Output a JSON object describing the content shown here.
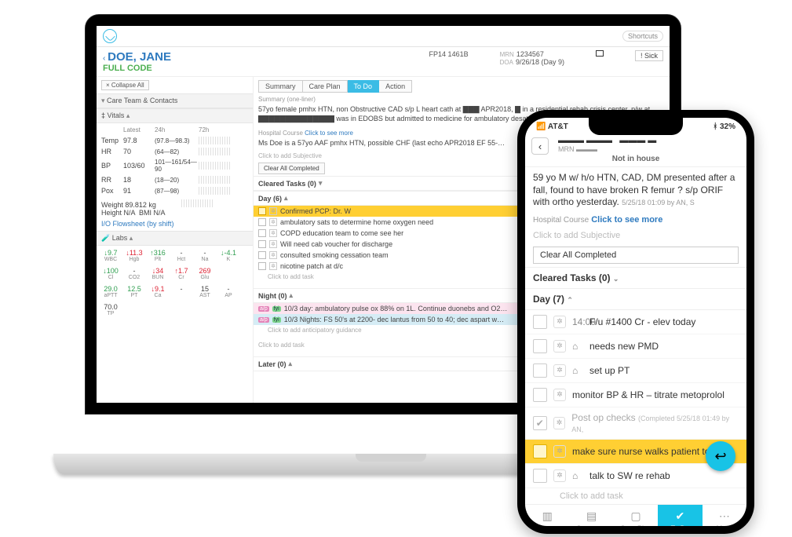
{
  "laptop": {
    "shortcut": "Shortcuts",
    "patient": {
      "name": "DOE, JANE",
      "code": "FULL CODE",
      "fp": "FP14 1461B",
      "mrn_label": "MRN",
      "mrn": "1234567",
      "doa_label": "DOA",
      "doa": "9/26/18 (Day 9)",
      "sick": "! Sick"
    },
    "collapse_all": "× Collapse All",
    "sidebar": {
      "care_team": "Care Team & Contacts",
      "vitals_label": "Vitals",
      "cols": {
        "latest": "Latest",
        "h24": "24h",
        "h72": "72h"
      },
      "vitals": [
        {
          "name": "Temp",
          "latest": "97.8",
          "h24": "(97.8—98.3)"
        },
        {
          "name": "HR",
          "latest": "70",
          "h24": "(64—82)"
        },
        {
          "name": "BP",
          "latest": "103/60",
          "h24": "101—161/54—90"
        },
        {
          "name": "RR",
          "latest": "18",
          "h24": "(18—20)"
        },
        {
          "name": "Pox",
          "latest": "91",
          "h24": "(87—98)"
        }
      ],
      "weight": "Weight 89.812 kg",
      "height": "Height N/A",
      "bmi": "BMI N/A",
      "flowsheet": "I/O Flowsheet (by shift)",
      "labs_label": "Labs",
      "labs1": [
        {
          "v": "↓9.7",
          "n": "WBC",
          "c": "green"
        },
        {
          "v": "↓11.3",
          "n": "Hgb",
          "c": "red"
        },
        {
          "v": "↑316",
          "n": "Plt",
          "c": "green"
        },
        {
          "v": "-",
          "n": "Hct",
          "c": ""
        },
        {
          "v": "-",
          "n": "Na",
          "c": ""
        },
        {
          "v": "↓-4.1",
          "n": "K",
          "c": "green"
        },
        {
          "v": "↓100",
          "n": "Cl",
          "c": "green"
        },
        {
          "v": "-",
          "n": "CO2",
          "c": ""
        },
        {
          "v": "↓34",
          "n": "BUN",
          "c": "red"
        },
        {
          "v": "↑1.7",
          "n": "Cr",
          "c": "red"
        },
        {
          "v": "269",
          "n": "Glu",
          "c": "red"
        }
      ],
      "labs2": [
        {
          "v": "29.0",
          "n": "aPTT",
          "c": "green"
        },
        {
          "v": "12.5",
          "n": "PT",
          "c": "green"
        },
        {
          "v": "↓9.1",
          "n": "Ca",
          "c": "red"
        },
        {
          "v": "-",
          "n": "",
          "c": ""
        },
        {
          "v": "15",
          "n": "AST",
          "c": ""
        },
        {
          "v": "-",
          "n": "AP",
          "c": ""
        },
        {
          "v": "70.0",
          "n": "TP",
          "c": ""
        }
      ]
    },
    "main": {
      "tabs": [
        "Summary",
        "Care Plan",
        "To Do",
        "Action"
      ],
      "active_tab": 2,
      "summary_label": "Summary (one-liner)",
      "summary": "57yo female pmhx HTN, non Obstructive CAD s/p L heart cath at ▇▇▇ APR2018, ▇ in a residential rehab crisis center, p/w at ▇▇▇▇▇▇▇▇▇▇▇▇▇▇ was in EDOBS but admitted to medicine for ambulatory desaturation",
      "hc_label": "Hospital Course",
      "hc_more": "Click to see more",
      "hc_text": "Ms Doe  is a 57yo AAF pmhx HTN, possible CHF (last echo APR2018 EF 55-…",
      "subjective_hint": "Click to add Subjective",
      "clear_btn": "Clear All Completed",
      "cleared": "Cleared Tasks (0)",
      "day": {
        "label": "Day (6)",
        "tasks": [
          {
            "text": "Confirmed PCP: Dr. W",
            "hl": true
          },
          {
            "text": "ambulatory sats to determine home oxygen need"
          },
          {
            "text": "COPD education team to come see her"
          },
          {
            "text": "Will need cab voucher for discharge"
          },
          {
            "text": "consulted smoking cessation team"
          },
          {
            "text": "nicotine patch at d/c"
          }
        ],
        "add_hint": "Click to add task"
      },
      "night": {
        "label": "Night (0)",
        "tasks": [
          {
            "tag1": "a/p",
            "tag2": "fyi",
            "cls": "pink",
            "text": "10/3 day: ambulatory pulse ox 88% on 1L. Continue duonebs and O2…"
          },
          {
            "tag1": "a/p",
            "tag2": "fyi",
            "cls": "blue",
            "text": "10/3 Nights: FS 50's at 2200- dec lantus from 50 to 40; dec aspart w…"
          }
        ],
        "guidance_hint": "Click to add anticipatory guidance",
        "add_hint": "Click to add task"
      },
      "later": {
        "label": "Later (0)"
      }
    }
  },
  "phone": {
    "status": {
      "carrier": "AT&T",
      "bt": "32%"
    },
    "mrn_label": "MRN",
    "not_in_house": "Not in house",
    "summary": "59 yo M w/ h/o HTN, CAD, DM presented after a fall, found to have broken R femur ? s/p ORIF with ortho yesterday.",
    "summary_meta": "5/25/18 01:09 by AN, S",
    "hc_label": "Hospital Course",
    "hc_more": "Click to see more",
    "subjective_hint": "Click to add Subjective",
    "clear_btn": "Clear All Completed",
    "cleared": "Cleared Tasks (0)",
    "day_label": "Day (7)",
    "tasks": [
      {
        "glyph": "14:00",
        "text": "F/u #1400 Cr - elev today"
      },
      {
        "glyph": "⌂",
        "text": "needs new PMD"
      },
      {
        "glyph": "⌂",
        "text": "set up PT"
      },
      {
        "glyph": "",
        "text": "monitor BP & HR – titrate metoprolol"
      },
      {
        "glyph": "",
        "text": "Post op checks",
        "done": true,
        "meta": "(Completed 5/25/18 01:49 by AN,"
      },
      {
        "glyph": "",
        "text": "make sure nurse walks patient today",
        "hl": true
      },
      {
        "glyph": "⌂",
        "text": "talk to SW re rehab"
      }
    ],
    "add_hint": "Click to add task",
    "tabbar": [
      "Chart",
      "Summary",
      "Care Plan",
      "To Do",
      "More"
    ],
    "tabbar_icons": [
      "▥",
      "▤",
      "▢",
      "✔",
      "⋯"
    ],
    "active": 3
  }
}
